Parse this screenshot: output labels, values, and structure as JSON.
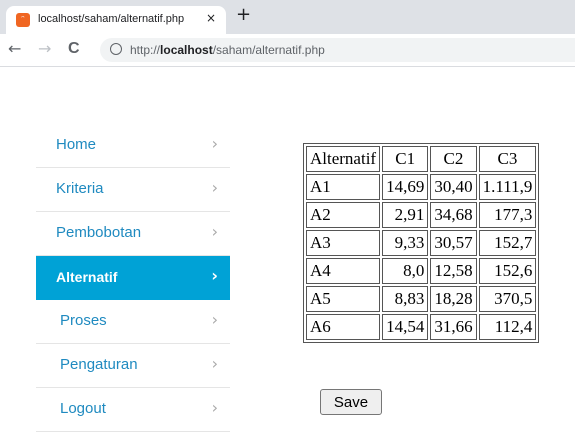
{
  "browser": {
    "tab_title": "localhost/saham/alternatif.php",
    "tab_close": "×",
    "new_tab": "+",
    "back": "←",
    "forward": "→",
    "reload": "C",
    "url_prefix": "http://",
    "url_host": "localhost",
    "url_path": "/saham/alternatif.php"
  },
  "sidebar": {
    "items": [
      {
        "label": "Home",
        "active": false
      },
      {
        "label": "Kriteria",
        "active": false
      },
      {
        "label": "Pembobotan",
        "active": false
      },
      {
        "label": "Alternatif",
        "active": true
      },
      {
        "label": "Proses",
        "active": false
      },
      {
        "label": "Pengaturan",
        "active": false
      },
      {
        "label": "Logout",
        "active": false
      }
    ]
  },
  "table": {
    "headers": [
      "Alternatif",
      "C1",
      "C2",
      "C3"
    ],
    "rows": [
      [
        "A1",
        "14,69",
        "30,40",
        "1.111,9"
      ],
      [
        "A2",
        "2,91",
        "34,68",
        "177,3"
      ],
      [
        "A3",
        "9,33",
        "30,57",
        "152,7"
      ],
      [
        "A4",
        "8,0",
        "12,58",
        "152,6"
      ],
      [
        "A5",
        "8,83",
        "18,28",
        "370,5"
      ],
      [
        "A6",
        "14,54",
        "31,66",
        "112,4"
      ]
    ]
  },
  "save_label": "Save",
  "colors": {
    "active_menu_bg": "#00a2d6",
    "menu_link": "#1f8ac0"
  }
}
